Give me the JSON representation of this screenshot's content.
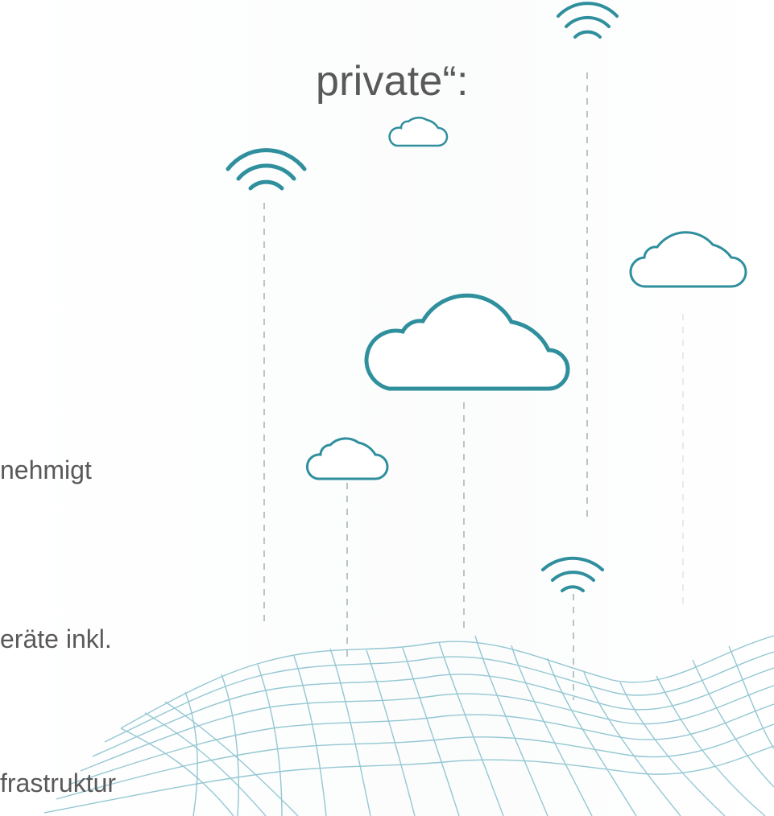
{
  "slide": {
    "heading": "private“:",
    "lines": [
      "nehmigt",
      "eräte inkl.",
      "frastruktur"
    ]
  },
  "colors": {
    "text": "#595959",
    "accent": "#2f8f9d",
    "mesh": "#8fc5d1",
    "dash": "#b9c4c8"
  },
  "icons": [
    "wifi-icon",
    "cloud-icon"
  ]
}
